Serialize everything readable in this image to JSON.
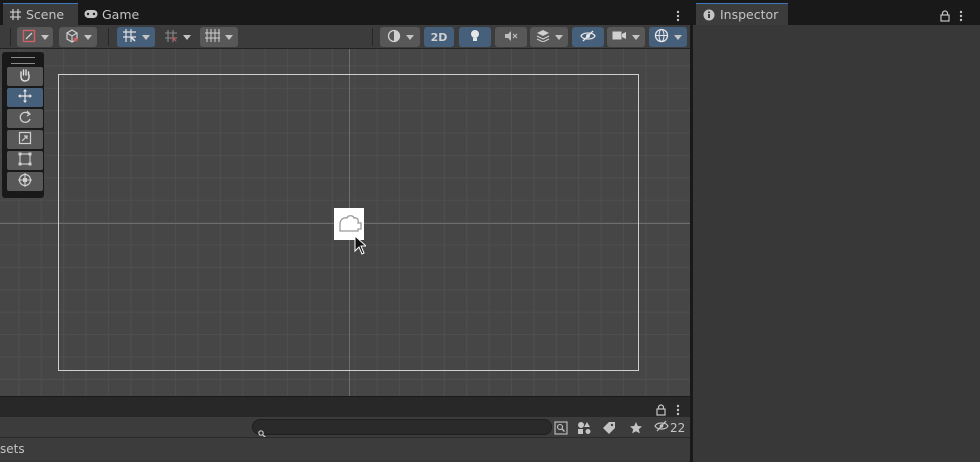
{
  "scene_window": {
    "tabs": [
      {
        "label": "Scene",
        "icon": "grid-icon",
        "active": true
      },
      {
        "label": "Game",
        "icon": "gamepad-icon",
        "active": false
      }
    ],
    "toolbar": {
      "mode_2d_label": "2D"
    }
  },
  "inspector": {
    "tab_label": "Inspector"
  },
  "project_panel": {
    "search_placeholder": "",
    "hidden_count": "22",
    "breadcrumb": "sets"
  },
  "colors": {
    "accent_blue": "#46607c",
    "tab_highlight": "#3a79bb",
    "viewport_bg": "#464646"
  }
}
